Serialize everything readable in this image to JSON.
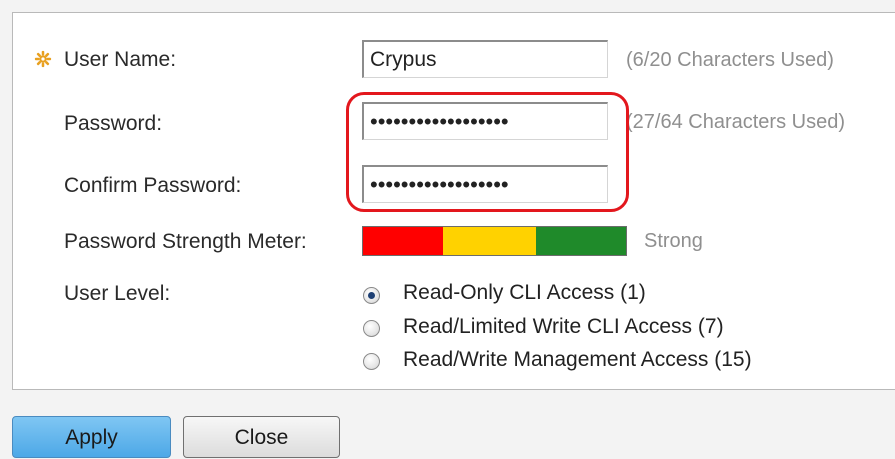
{
  "form": {
    "username": {
      "label": "User Name:",
      "value": "Crypus",
      "hint": "(6/20 Characters Used)"
    },
    "password": {
      "label": "Password:",
      "value": "••••••••••••••••••",
      "hint": "(27/64 Characters Used)"
    },
    "confirm_password": {
      "label": "Confirm Password:",
      "value": "••••••••••••••••••"
    },
    "strength_meter": {
      "label": "Password Strength Meter:",
      "status": "Strong",
      "segment_colors": [
        "#ff0000",
        "#ffd200",
        "#1f8a2a"
      ]
    },
    "user_level": {
      "label": "User Level:",
      "options": [
        {
          "label": "Read-Only CLI Access (1)",
          "checked": true
        },
        {
          "label": "Read/Limited Write CLI Access (7)",
          "checked": false
        },
        {
          "label": "Read/Write Management Access (15)",
          "checked": false
        }
      ]
    }
  },
  "buttons": {
    "apply": "Apply",
    "close": "Close"
  },
  "colors": {
    "highlight": "#e3171d",
    "apply_bg": "#5bb4ee",
    "required_icon": "#e8a020"
  }
}
